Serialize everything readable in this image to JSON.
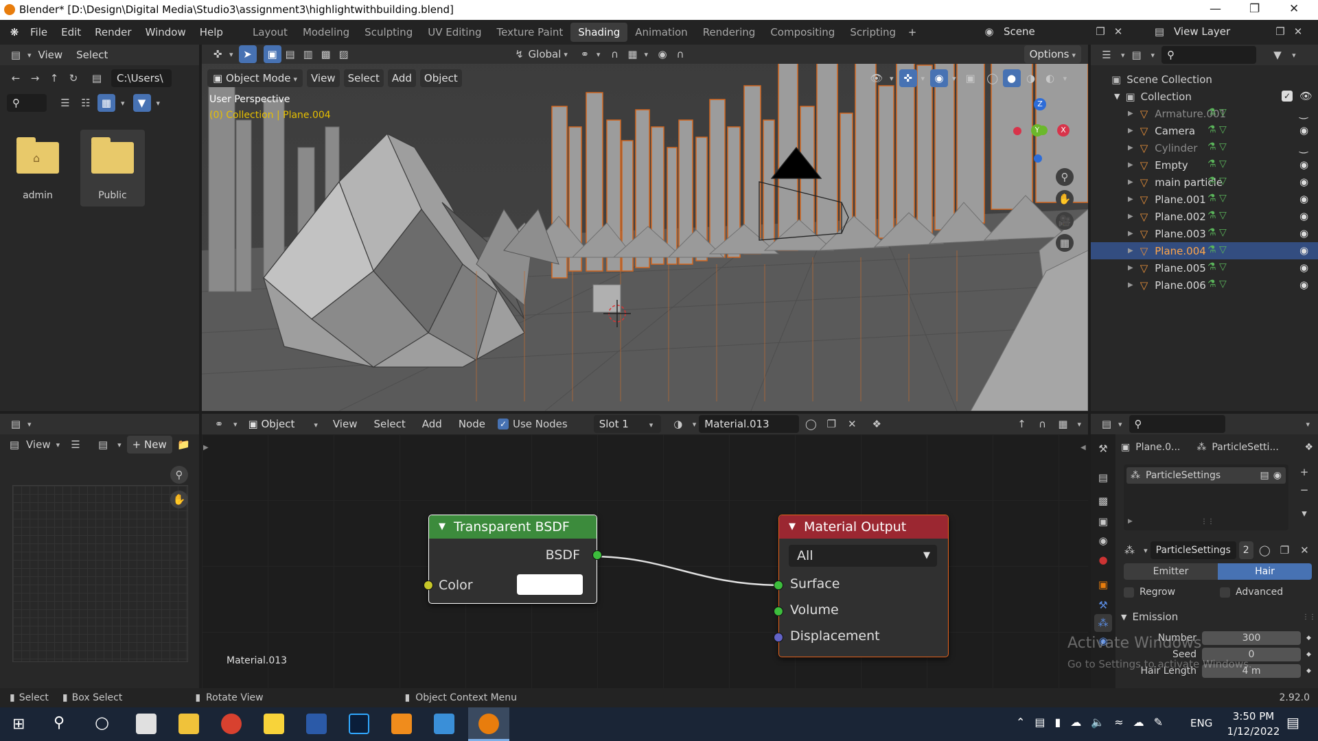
{
  "window": {
    "title": "Blender* [D:\\Design\\Digital Media\\Studio3\\assignment3\\highlightwithbuilding.blend]"
  },
  "menu": [
    "File",
    "Edit",
    "Render",
    "Window",
    "Help"
  ],
  "workspaces": {
    "tabs": [
      "Layout",
      "Modeling",
      "Sculpting",
      "UV Editing",
      "Texture Paint",
      "Shading",
      "Animation",
      "Rendering",
      "Compositing",
      "Scripting"
    ],
    "active": "Shading"
  },
  "scene": {
    "name": "Scene",
    "view_layer": "View Layer"
  },
  "file_browser": {
    "menu": [
      "View",
      "Select"
    ],
    "path": "C:\\Users\\",
    "folders": [
      "admin",
      "Public"
    ]
  },
  "viewport": {
    "mode": "Object Mode",
    "menu": [
      "View",
      "Select",
      "Add",
      "Object"
    ],
    "transform": "Global",
    "options": "Options",
    "perspective": "User Perspective",
    "active": "(0) Collection | Plane.004",
    "gizmo": {
      "z": "Z",
      "y": "Y",
      "x": "X"
    }
  },
  "outliner": {
    "root": "Scene Collection",
    "collection": "Collection",
    "items": [
      {
        "name": "Armature.001",
        "dim": true
      },
      {
        "name": "Camera",
        "dim": false
      },
      {
        "name": "Cylinder",
        "dim": true
      },
      {
        "name": "Empty",
        "dim": false
      },
      {
        "name": "main particle",
        "dim": false
      },
      {
        "name": "Plane.001",
        "dim": false
      },
      {
        "name": "Plane.002",
        "dim": false
      },
      {
        "name": "Plane.003",
        "dim": false
      },
      {
        "name": "Plane.004",
        "dim": false,
        "selected": true
      },
      {
        "name": "Plane.005",
        "dim": false
      },
      {
        "name": "Plane.006",
        "dim": false
      }
    ]
  },
  "image_editor": {
    "view": "View",
    "new": "New"
  },
  "node_editor": {
    "type": "Object",
    "menu": [
      "View",
      "Select",
      "Add",
      "Node"
    ],
    "use_nodes": "Use Nodes",
    "slot": "Slot 1",
    "material": "Material.013",
    "footer": "Material.013",
    "nodes": {
      "transparent": {
        "title": "Transparent BSDF",
        "output": "BSDF",
        "input": "Color"
      },
      "output": {
        "title": "Material Output",
        "target": "All",
        "inputs": [
          "Surface",
          "Volume",
          "Displacement"
        ]
      }
    }
  },
  "properties": {
    "tabs": [
      "Plane.0...",
      "ParticleSetti..."
    ],
    "system": "ParticleSettings",
    "settings_name": "ParticleSettings",
    "users": "2",
    "type_options": [
      "Emitter",
      "Hair"
    ],
    "type_active": "Hair",
    "regrow": "Regrow",
    "advanced": "Advanced",
    "section": "Emission",
    "fields": [
      {
        "label": "Number",
        "value": "300"
      },
      {
        "label": "Seed",
        "value": "0"
      },
      {
        "label": "Hair Length",
        "value": "4 m"
      }
    ],
    "watermark1": "Activate Windows",
    "watermark2": "Go to Settings to activate Windows."
  },
  "status_bar": {
    "select": "Select",
    "box_select": "Box Select",
    "rotate": "Rotate View",
    "context": "Object Context Menu",
    "version": "2.92.0"
  },
  "taskbar": {
    "lang": "ENG",
    "time": "3:50 PM",
    "date": "1/12/2022"
  },
  "colors": {
    "accent": "#4772b3",
    "selection": "#334d80",
    "orange": "#e87d0d",
    "node_green": "#3c8b3c",
    "node_red": "#9b2731"
  }
}
